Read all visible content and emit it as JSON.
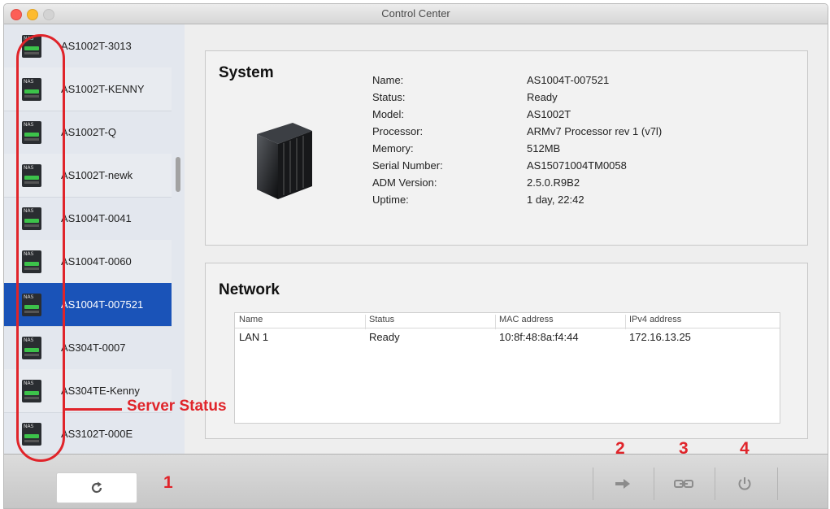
{
  "window": {
    "title": "Control Center"
  },
  "sidebar": {
    "icon_text": "NAS",
    "servers": [
      {
        "name": "AS1002T-3013"
      },
      {
        "name": "AS1002T-KENNY"
      },
      {
        "name": "AS1002T-Q"
      },
      {
        "name": "AS1002T-newk"
      },
      {
        "name": "AS1004T-0041"
      },
      {
        "name": "AS1004T-0060"
      },
      {
        "name": "AS1004T-007521",
        "selected": true
      },
      {
        "name": "AS304T-0007"
      },
      {
        "name": "AS304TE-Kenny"
      },
      {
        "name": "AS3102T-000E"
      }
    ]
  },
  "annotations": {
    "server_status": "Server Status",
    "n1": "1",
    "n2": "2",
    "n3": "3",
    "n4": "4",
    "color": "#e0242a"
  },
  "system": {
    "title": "System",
    "rows": [
      {
        "label": "Name:",
        "value": "AS1004T-007521"
      },
      {
        "label": "Status:",
        "value": "Ready"
      },
      {
        "label": "Model:",
        "value": "AS1002T"
      },
      {
        "label": "Processor:",
        "value": "ARMv7 Processor rev 1 (v7l)"
      },
      {
        "label": "Memory:",
        "value": "512MB"
      },
      {
        "label": "Serial Number:",
        "value": "AS15071004TM0058"
      },
      {
        "label": "ADM Version:",
        "value": "2.5.0.R9B2"
      },
      {
        "label": "Uptime:",
        "value": "1 day, 22:42"
      }
    ]
  },
  "network": {
    "title": "Network",
    "columns": [
      "Name",
      "Status",
      "MAC address",
      "IPv4 address"
    ],
    "rows": [
      [
        "LAN 1",
        "Ready",
        "10:8f:48:8a:f4:44",
        "172.16.13.25"
      ]
    ]
  },
  "toolbar": {
    "refresh_icon": "refresh-icon",
    "connect_icon": "arrow-right-icon",
    "map_drive_icon": "link-icon",
    "power_icon": "power-icon"
  },
  "colors": {
    "selection": "#1a53b8",
    "accent_red": "#e0242a",
    "led_green": "#3cc24a"
  }
}
